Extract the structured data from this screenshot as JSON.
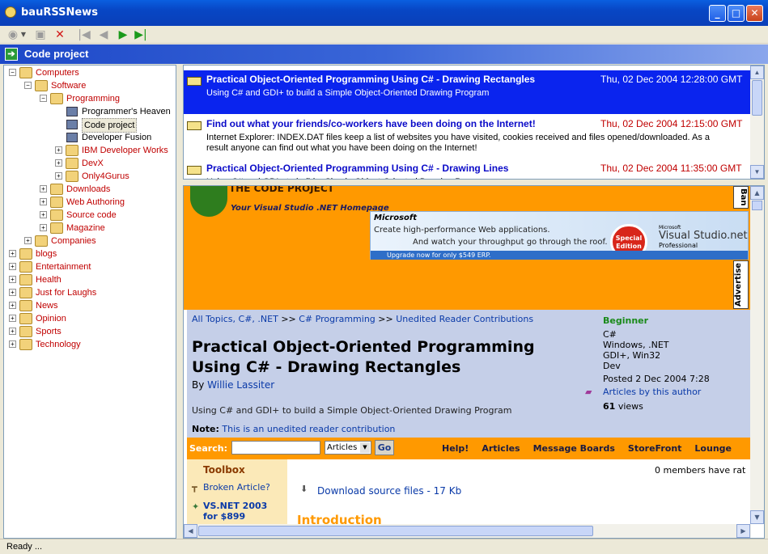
{
  "window": {
    "title": "bauRSSNews",
    "minimize": "_",
    "maximize": "□",
    "close": "✕"
  },
  "toolbar": {
    "icons": [
      "globe-icon",
      "folder-icon",
      "delete-icon",
      "first-icon",
      "prev-icon",
      "next-icon",
      "last-icon"
    ]
  },
  "channel": {
    "title": "Code project"
  },
  "tree": [
    {
      "label": "Computers",
      "level": 0,
      "exp": "−",
      "type": "folder"
    },
    {
      "label": "Software",
      "level": 1,
      "exp": "−",
      "type": "folder"
    },
    {
      "label": "Programming",
      "level": 2,
      "exp": "−",
      "type": "folder"
    },
    {
      "label": "Programmer's Heaven",
      "level": 3,
      "exp": "",
      "type": "feed"
    },
    {
      "label": "Code project",
      "level": 3,
      "exp": "",
      "type": "feed",
      "selected": true
    },
    {
      "label": "Developer Fusion",
      "level": 3,
      "exp": "",
      "type": "feed"
    },
    {
      "label": "IBM Developer Works",
      "level": 3,
      "exp": "+",
      "type": "folder"
    },
    {
      "label": "DevX",
      "level": 3,
      "exp": "+",
      "type": "folder"
    },
    {
      "label": "Only4Gurus",
      "level": 3,
      "exp": "+",
      "type": "folder"
    },
    {
      "label": "Downloads",
      "level": 2,
      "exp": "+",
      "type": "folder"
    },
    {
      "label": "Web Authoring",
      "level": 2,
      "exp": "+",
      "type": "folder"
    },
    {
      "label": "Source code",
      "level": 2,
      "exp": "+",
      "type": "folder"
    },
    {
      "label": "Magazine",
      "level": 2,
      "exp": "+",
      "type": "folder"
    },
    {
      "label": "Companies",
      "level": 1,
      "exp": "+",
      "type": "folder"
    },
    {
      "label": "blogs",
      "level": 0,
      "exp": "+",
      "type": "folder"
    },
    {
      "label": "Entertainment",
      "level": 0,
      "exp": "+",
      "type": "folder"
    },
    {
      "label": "Health",
      "level": 0,
      "exp": "+",
      "type": "folder"
    },
    {
      "label": "Just for Laughs",
      "level": 0,
      "exp": "+",
      "type": "folder"
    },
    {
      "label": "News",
      "level": 0,
      "exp": "+",
      "type": "folder"
    },
    {
      "label": "Opinion",
      "level": 0,
      "exp": "+",
      "type": "folder"
    },
    {
      "label": "Sports",
      "level": 0,
      "exp": "+",
      "type": "folder"
    },
    {
      "label": "Technology",
      "level": 0,
      "exp": "+",
      "type": "folder"
    }
  ],
  "items": [
    {
      "title": "Practical Object-Oriented Programming Using C# - Drawing Rectangles",
      "date": "Thu, 02 Dec 2004 12:28:00 GMT",
      "desc": "Using C# and GDI+ to build a Simple Object-Oriented Drawing Program",
      "selected": true
    },
    {
      "title": "Find out what your friends/co-workers have been doing on the Internet!",
      "date": "Thu, 02 Dec 2004 12:15:00 GMT",
      "desc": "Internet Explorer: INDEX.DAT files keep a list of websites you have visited, cookies received and files opened/downloaded. As a result anyone can find out what you have been doing on the Internet!",
      "selected": false
    },
    {
      "title": "Practical Object-Oriented Programming Using C# - Drawing Lines",
      "date": "Thu, 02 Dec 2004 11:35:00 GMT",
      "desc": "Using C# and GDI+ to build a Simple Object-Oriented Drawing Program",
      "selected": false
    }
  ],
  "web": {
    "site_tagline": "Your Visual Studio .NET Homepage",
    "site_logo_text": "THE CODE PROJECT",
    "ad": {
      "brand": "Microsoft",
      "line1": "Create high-performance Web applications.",
      "line2": "And watch your throughput go through the roof.",
      "badge": "Special Edition",
      "product_small": "Microsoft",
      "product": "Visual Studio.net",
      "product_sub": "Professional",
      "cta": "Upgrade now for only $549 ERP.",
      "side_label": "Advertise",
      "side_label2": "Ban"
    },
    "crumbs": {
      "topics": "All Topics, C#, .NET",
      "sep": ">>",
      "cat": "C# Programming",
      "sub": "Unedited Reader Contributions"
    },
    "article": {
      "title": "Practical Object-Oriented Programming Using C# - Drawing Rectangles",
      "by": "By",
      "author": "Willie Lassiter",
      "summary": "Using C# and GDI+ to build a Simple Object-Oriented Drawing Program",
      "note_label": "Note:",
      "note": "This is an unedited reader contribution"
    },
    "meta": {
      "level": "Beginner",
      "lang": "C#",
      "platform": "Windows, .NET",
      "tech": "GDI+, Win32",
      "type": "Dev",
      "posted": "Posted 2 Dec 2004 7:28",
      "author_link": "Articles by this author",
      "views_num": "61",
      "views_label": "views"
    },
    "search": {
      "label": "Search:",
      "select": "Articles",
      "go": "Go",
      "nav": [
        "Help!",
        "Articles",
        "Message Boards",
        "StoreFront",
        "Lounge"
      ]
    },
    "toolbox": {
      "title": "Toolbox",
      "broken": "Broken Article?",
      "vsnet": "VS.NET 2003 for $899"
    },
    "rating": "0 members have rat",
    "download": "Download source files - 17 Kb",
    "intro": "Introduction"
  },
  "status": {
    "text": "Ready ..."
  },
  "colors": {
    "accent": "#0a24ee",
    "link": "#0a3aa8",
    "tree_red": "#c00000",
    "orange": "#ff9900"
  }
}
